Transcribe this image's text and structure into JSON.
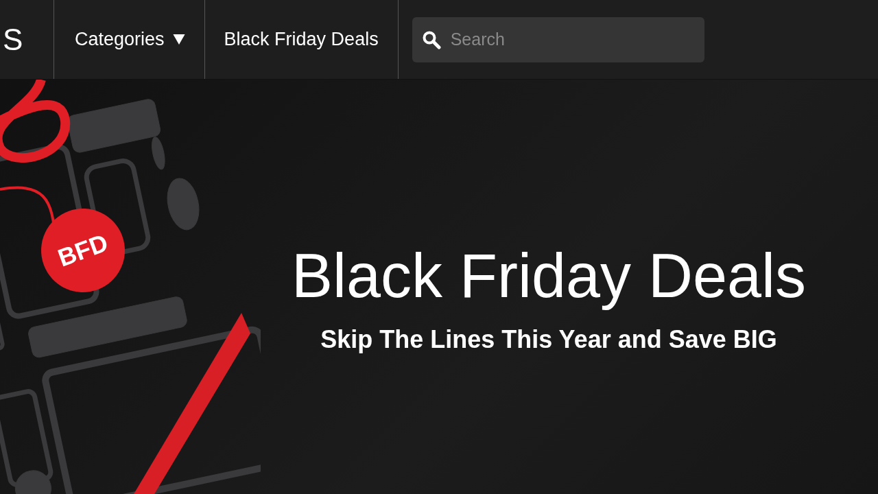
{
  "nav": {
    "logo_fragment": "S",
    "items": [
      {
        "label": "Categories",
        "has_menu": true
      },
      {
        "label": "Black Friday Deals",
        "has_menu": false
      }
    ],
    "search": {
      "placeholder": "Search"
    }
  },
  "hero": {
    "tag": "BFD",
    "title": "Black Friday Deals",
    "subtitle": "Skip The Lines This Year and Save BIG"
  }
}
